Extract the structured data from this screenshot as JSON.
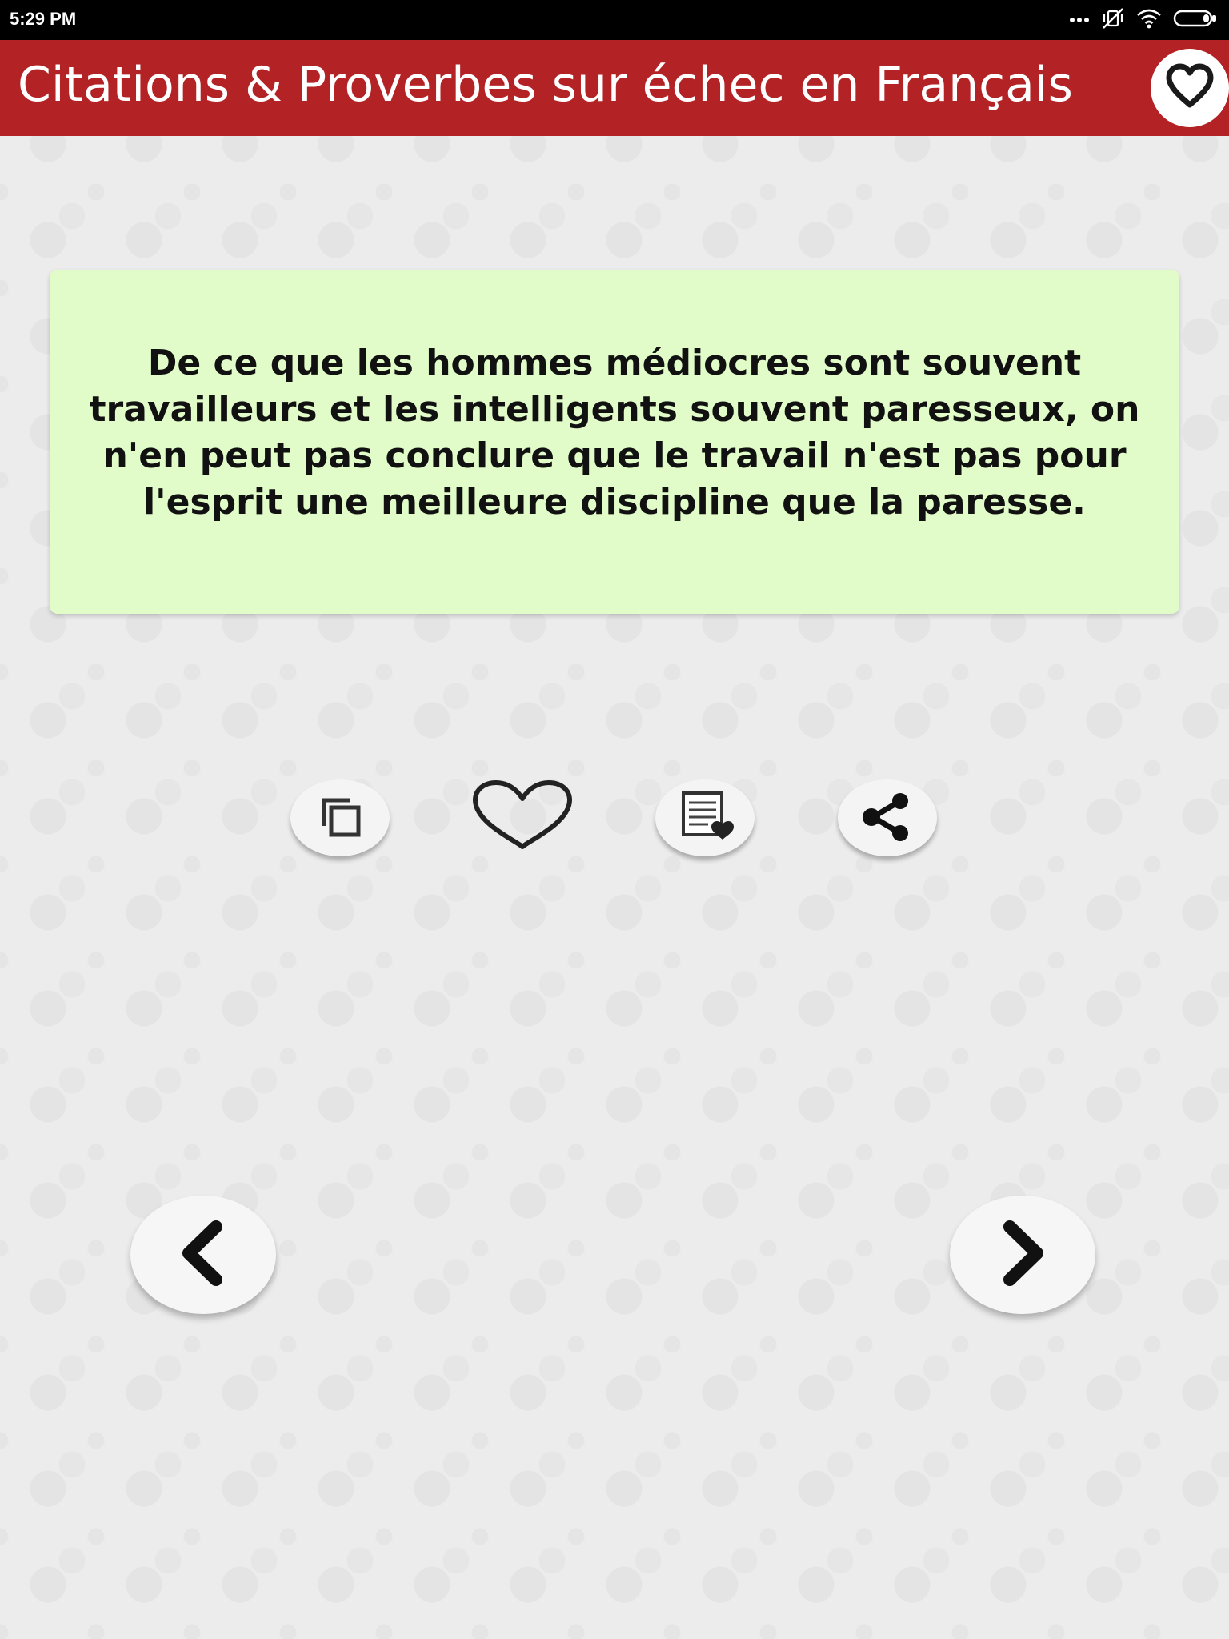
{
  "status_bar": {
    "time": "5:29 PM",
    "icons": [
      "more-dots-icon",
      "vibrate-off-icon",
      "wifi-icon",
      "battery-icon"
    ]
  },
  "app_bar": {
    "title": "Citations & Proverbes sur échec en Français",
    "action_icon": "heart-icon",
    "color": "#b32224"
  },
  "quote": {
    "text": "De ce que les hommes médiocres sont souvent travailleurs et les intelligents souvent paresseux, on n'en peut pas conclure que le travail n'est pas pour l'esprit une meilleure discipline que la paresse.",
    "card_color": "#e1fcc8"
  },
  "actions": [
    {
      "icon": "copy-icon"
    },
    {
      "icon": "heart-outline-icon"
    },
    {
      "icon": "favorites-list-icon"
    },
    {
      "icon": "share-icon"
    }
  ],
  "navigation": {
    "previous_icon": "chevron-left-icon",
    "next_icon": "chevron-right-icon"
  }
}
